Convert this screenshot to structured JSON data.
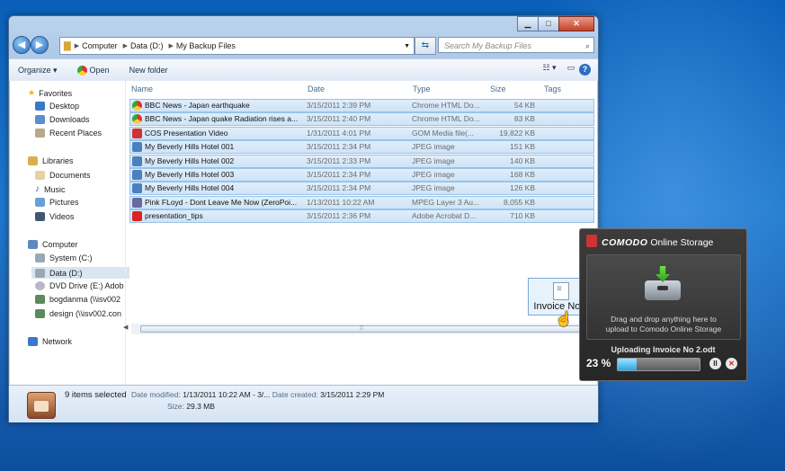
{
  "window": {
    "breadcrumbs": [
      "Computer",
      "Data (D:)",
      "My Backup Files"
    ],
    "search_placeholder": "Search My Backup Files",
    "buttons": {
      "minimize": "▁",
      "maximize": "□",
      "close": "✕"
    }
  },
  "toolbar": {
    "organize": "Organize ▾",
    "open": "Open",
    "new_folder": "New folder"
  },
  "sidebar": {
    "favorites": {
      "title": "Favorites",
      "items": [
        "Desktop",
        "Downloads",
        "Recent Places"
      ]
    },
    "libraries": {
      "title": "Libraries",
      "items": [
        "Documents",
        "Music",
        "Pictures",
        "Videos"
      ]
    },
    "computer": {
      "title": "Computer",
      "items": [
        "System (C:)",
        "Data (D:)",
        "DVD Drive (E:) Adob",
        "bogdanma (\\\\isv002",
        "design (\\\\isv002.con"
      ]
    },
    "network": {
      "title": "Network"
    }
  },
  "columns": {
    "name": "Name",
    "date": "Date",
    "type": "Type",
    "size": "Size",
    "tags": "Tags"
  },
  "files": [
    {
      "name": "BBC News - Japan earthquake",
      "date": "3/15/2011 2:39 PM",
      "type": "Chrome HTML Do...",
      "size": "54 KB",
      "icon": "chrome-icon"
    },
    {
      "name": "BBC News - Japan quake  Radiation rises a...",
      "date": "3/15/2011 2:40 PM",
      "type": "Chrome HTML Do...",
      "size": "83 KB",
      "icon": "chrome-icon"
    },
    {
      "name": "COS Presentation Video",
      "date": "1/31/2011 4:01 PM",
      "type": "GOM Media file(...",
      "size": "19,822 KB",
      "icon": "video-icon"
    },
    {
      "name": "My Beverly Hills Hotel 001",
      "date": "3/15/2011 2:34 PM",
      "type": "JPEG image",
      "size": "151 KB",
      "icon": "image-icon"
    },
    {
      "name": "My Beverly Hills Hotel 002",
      "date": "3/15/2011 2:33 PM",
      "type": "JPEG image",
      "size": "140 KB",
      "icon": "image-icon"
    },
    {
      "name": "My Beverly Hills Hotel 003",
      "date": "3/15/2011 2:34 PM",
      "type": "JPEG image",
      "size": "168 KB",
      "icon": "image-icon"
    },
    {
      "name": "My Beverly Hills Hotel 004",
      "date": "3/15/2011 2:34 PM",
      "type": "JPEG image",
      "size": "126 KB",
      "icon": "image-icon"
    },
    {
      "name": "Pink FLoyd - Dont Leave Me Now (ZeroPoi...",
      "date": "1/13/2011 10:22 AM",
      "type": "MPEG Layer 3 Au...",
      "size": "8,055 KB",
      "icon": "audio-icon"
    },
    {
      "name": "presentation_tips",
      "date": "3/15/2011 2:36 PM",
      "type": "Adobe Acrobat D...",
      "size": "710 KB",
      "icon": "pdf-icon"
    }
  ],
  "details": {
    "selected": "9 items selected",
    "date_modified_label": "Date modified:",
    "date_modified": "1/13/2011 10:22 AM - 3/...",
    "date_created_label": "Date created:",
    "date_created": "3/15/2011 2:29 PM",
    "size_label": "Size:",
    "size": "29.3 MB"
  },
  "drag": {
    "label": "Invoice No 2"
  },
  "comodo": {
    "brand": "COMODO",
    "title": "Online Storage",
    "drop_text_1": "Drag and drop anything here to",
    "drop_text_2": "upload to Comodo Online Storage",
    "uploading": "Uploading Invoice No 2.odt",
    "percent_label": "23 %",
    "progress": 0.23,
    "pause": "II",
    "cancel": "✕"
  },
  "colors": {
    "selection": "#cfe4f7",
    "selection_border": "#99c3ea",
    "accent": "#2a6fc0",
    "desktop": "#1f78cc",
    "panel": "#2f2f2f"
  }
}
